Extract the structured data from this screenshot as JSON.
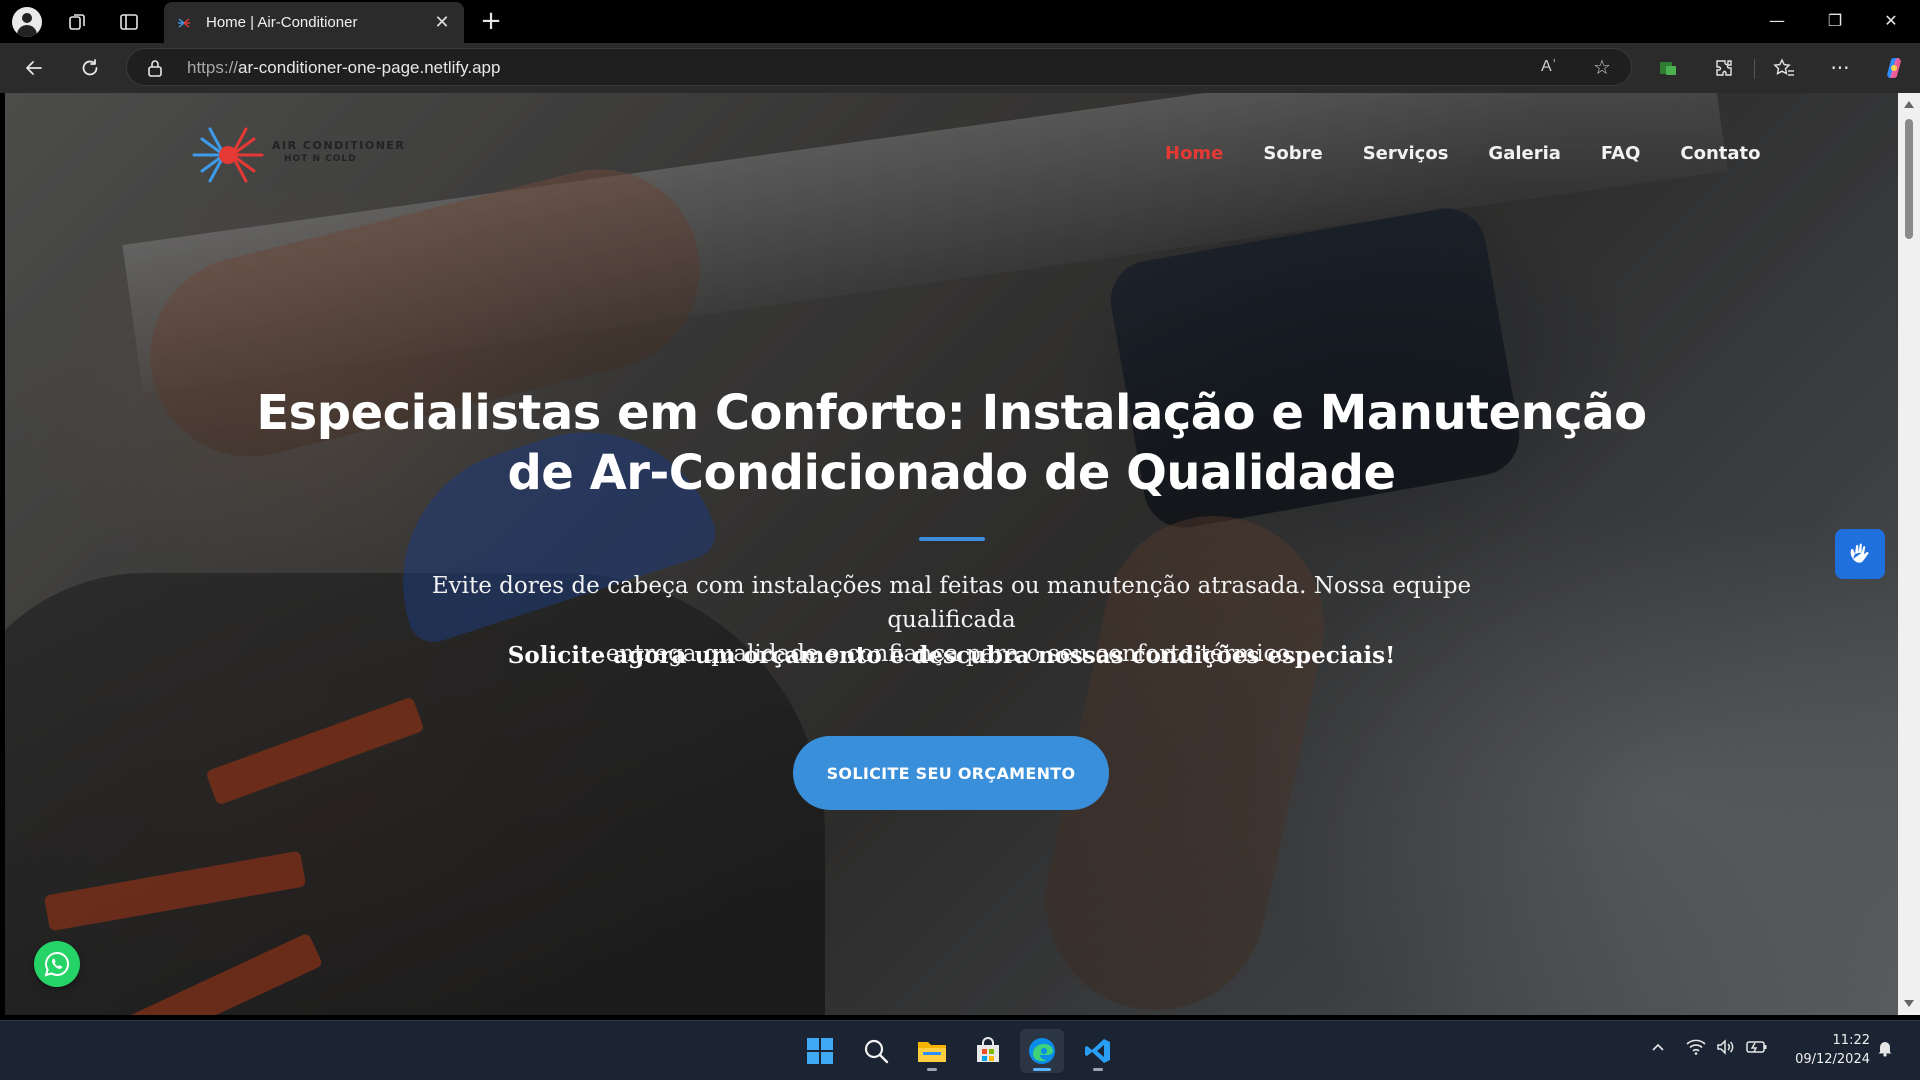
{
  "browser": {
    "tab": {
      "title": "Home | Air-Conditioner",
      "close_glyph": "✕"
    },
    "new_tab_glyph": "+",
    "url": {
      "protocol": "https://",
      "host": "ar-conditioner-one-page.netlify.app"
    },
    "read_aloud": "Aʾ",
    "window_controls": {
      "minimize": "—",
      "maximize": "❐",
      "close": "✕"
    },
    "icons": [
      "profile-icon",
      "workspaces-icon",
      "tab-actions-icon",
      "back-icon",
      "reload-icon",
      "lock-icon",
      "read-aloud-icon",
      "favorite-star-icon",
      "extension-icon",
      "puzzle-icon",
      "favorites-icon",
      "more-icon",
      "copilot-icon"
    ]
  },
  "site": {
    "logo": {
      "line1": "AIR CONDITIONER",
      "line2": "HOT N COLD"
    },
    "nav": [
      {
        "label": "Home",
        "active": true
      },
      {
        "label": "Sobre",
        "active": false
      },
      {
        "label": "Serviços",
        "active": false
      },
      {
        "label": "Galeria",
        "active": false
      },
      {
        "label": "FAQ",
        "active": false
      },
      {
        "label": "Contato",
        "active": false
      }
    ],
    "hero": {
      "title_line1": "Especialistas em Conforto: Instalação e Manutenção",
      "title_line2": "de Ar-Condicionado de Qualidade",
      "subtitle_line1": "Evite dores de cabeça com instalações mal feitas ou manutenção atrasada. Nossa equipe qualificada",
      "subtitle_line2": "entrega qualidade e confiança para o seu conforto térmico.",
      "cta_text": "Solicite agora um orçamento e descubra nossas condições especiais!",
      "cta_button": "SOLICITE SEU ORÇAMENTO"
    },
    "colors": {
      "active_nav": "#e53935",
      "accent": "#3a8fdb",
      "whatsapp": "#25d366",
      "accessibility": "#1f6fdc"
    }
  },
  "taskbar": {
    "apps": [
      "windows-start-icon",
      "search-icon",
      "file-explorer-icon",
      "microsoft-store-icon",
      "edge-icon",
      "vscode-icon"
    ],
    "clock": {
      "time": "11:22",
      "date": "09/12/2024"
    }
  }
}
